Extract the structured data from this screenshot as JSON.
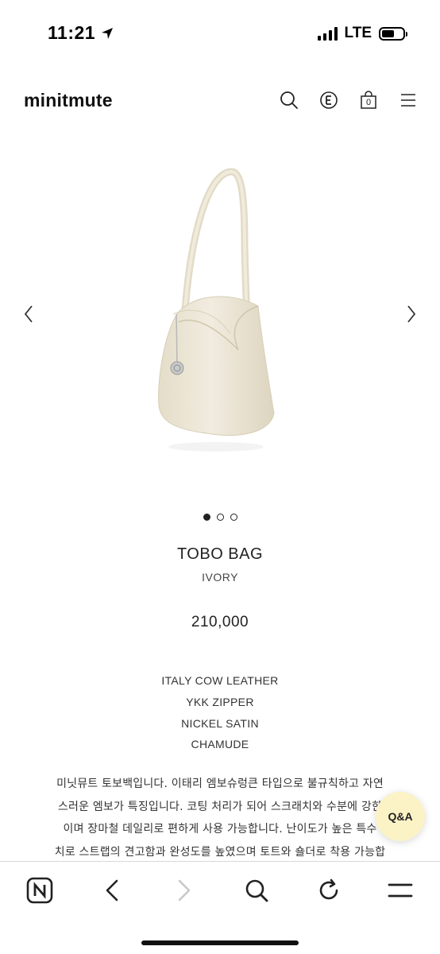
{
  "status_bar": {
    "time": "11:21",
    "network": "LTE"
  },
  "header": {
    "brand": "minitmute",
    "cart_count": "0",
    "icons": [
      "search-icon",
      "e-badge-icon",
      "shopping-bag-icon",
      "hamburger-menu-icon"
    ]
  },
  "gallery": {
    "image_count": 3,
    "active_index": 0
  },
  "product": {
    "name": "TOBO BAG",
    "color": "IVORY",
    "price": "210,000",
    "specs": [
      "ITALY COW LEATHER",
      "YKK ZIPPER",
      "NICKEL SATIN",
      "CHAMUDE"
    ],
    "description_lines": [
      "미닛뮤트 토보백입니다. 이태리 엠보슈렁큰 타입으로 불규칙하고 자연",
      "스러운 엠보가 특징입니다. 코팅 처리가 되어 스크래치와 수분에 강한",
      "이며 장마철 데일리로 편하게 사용 가능합니다. 난이도가 높은 특수",
      "치로 스트랩의 견고함과 완성도를 높였으며 토트와 숄더로 착용 가능합"
    ]
  },
  "qa_button": {
    "label": "Q&A"
  },
  "browser_toolbar": {
    "icons": [
      "naver-home-icon",
      "back-arrow-icon",
      "forward-arrow-icon",
      "search-icon",
      "refresh-icon",
      "menu-icon"
    ]
  },
  "colors": {
    "bag_ivory": "#ece6d5",
    "qa_background": "#fbf3c6",
    "text": "#222222"
  }
}
